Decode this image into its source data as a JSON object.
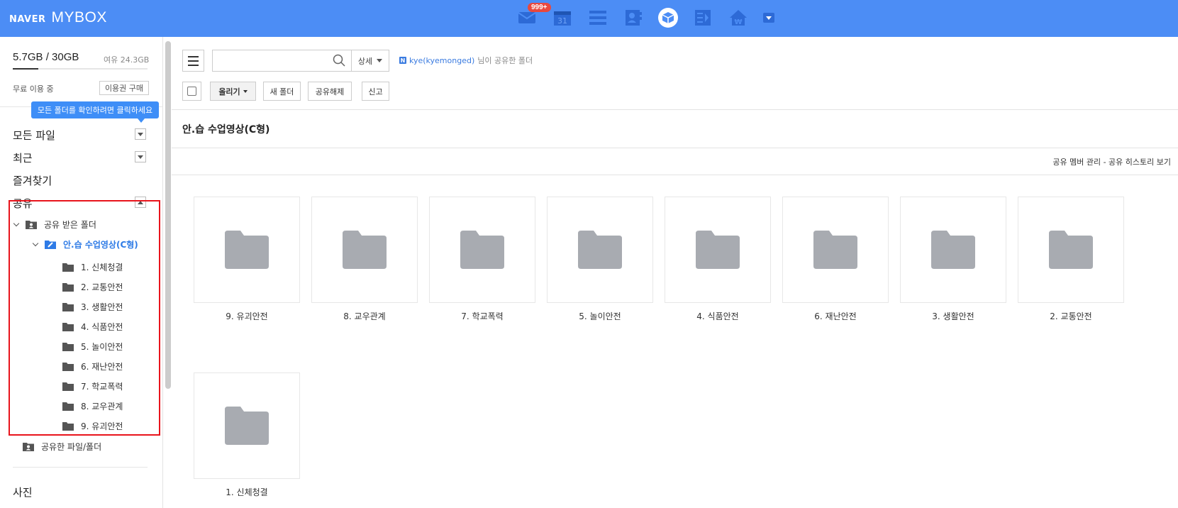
{
  "header": {
    "brand_naver": "NAVER",
    "brand_mybox": "MYBOX",
    "mail_badge": "999+",
    "calendar_day": "31",
    "apps": [
      "mail-icon",
      "calendar-icon",
      "list-icon",
      "contacts-icon",
      "mybox-icon",
      "memo-icon",
      "pay-icon"
    ]
  },
  "sidebar": {
    "storage_used": "5.7GB",
    "storage_sep": " / ",
    "storage_total": "30GB",
    "storage_free": "여유 24.3GB",
    "usage_fraction": 0.19,
    "plan_status": "무료 이용 중",
    "buy_button": "이용권 구매",
    "tooltip": "모든 폴더를 확인하려면 클릭하세요",
    "nav": {
      "all_files": "모든 파일",
      "recent": "최근",
      "favorites": "즐겨찾기",
      "shared": "공유",
      "photos": "사진"
    },
    "tree": {
      "received_folder": "공유 받은 폴더",
      "current_folder": "안.습 수업영상(C형)",
      "children": [
        "1. 신체청결",
        "2. 교통안전",
        "3. 생활안전",
        "4. 식품안전",
        "5. 놀이안전",
        "6. 재난안전",
        "7. 학교폭력",
        "8. 교우관계",
        "9. 유괴안전"
      ],
      "shared_by_me": "공유한 파일/폴더"
    }
  },
  "toolbar": {
    "search_placeholder": "",
    "detail_label": "상세",
    "owner": "kye(kyemonged)",
    "owner_suffix": "님이 공유한 폴더",
    "upload_label": "올리기",
    "new_folder_label": "새 폴더",
    "unshare_label": "공유해제",
    "report_label": "신고"
  },
  "content": {
    "folder_title": "안.습 수업영상(C형)",
    "share_links": "공유 멤버 관리 - 공유 히스토리 보기",
    "folders": [
      "9. 유괴안전",
      "8. 교우관계",
      "7. 학교폭력",
      "5. 놀이안전",
      "4. 식품안전",
      "6. 재난안전",
      "3. 생활안전",
      "2. 교통안전",
      "1. 신체청결"
    ]
  },
  "colors": {
    "header_bg": "#4c8df5",
    "accent": "#2e7be6",
    "highlight": "#e8141c",
    "folder_gray": "#a8abb1"
  }
}
